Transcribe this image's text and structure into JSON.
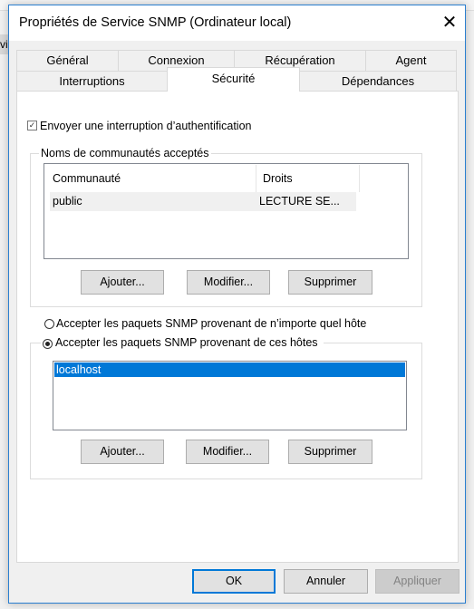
{
  "background": {
    "fragment": "vi"
  },
  "window": {
    "title": "Propriétés de Service SNMP (Ordinateur local)",
    "close_icon": "close-icon"
  },
  "tabs": {
    "row1": [
      "Général",
      "Connexion",
      "Récupération",
      "Agent"
    ],
    "row2": [
      "Interruptions",
      "Sécurité",
      "Dépendances"
    ],
    "selected": "Sécurité"
  },
  "security": {
    "auth_trap": {
      "label": "Envoyer une interruption d’authentification",
      "checked": true
    },
    "communities": {
      "legend": "Noms de communautés acceptés",
      "columns": [
        "Communauté",
        "Droits"
      ],
      "rows": [
        {
          "community": "public",
          "rights": "LECTURE SE..."
        }
      ],
      "buttons": [
        "Ajouter...",
        "Modifier...",
        "Supprimer"
      ]
    },
    "accept_any": {
      "label": "Accepter les paquets SNMP provenant de n’importe quel hôte",
      "selected": false
    },
    "accept_these": {
      "label": "Accepter les paquets SNMP provenant de ces hôtes",
      "selected": true
    },
    "hosts": [
      "localhost"
    ],
    "hosts_buttons": [
      "Ajouter...",
      "Modifier...",
      "Supprimer"
    ]
  },
  "footer": {
    "ok": "OK",
    "cancel": "Annuler",
    "apply": "Appliquer",
    "apply_disabled": true
  },
  "colors": {
    "selection": "#0078d7",
    "window_border": "#2b7fd0"
  }
}
